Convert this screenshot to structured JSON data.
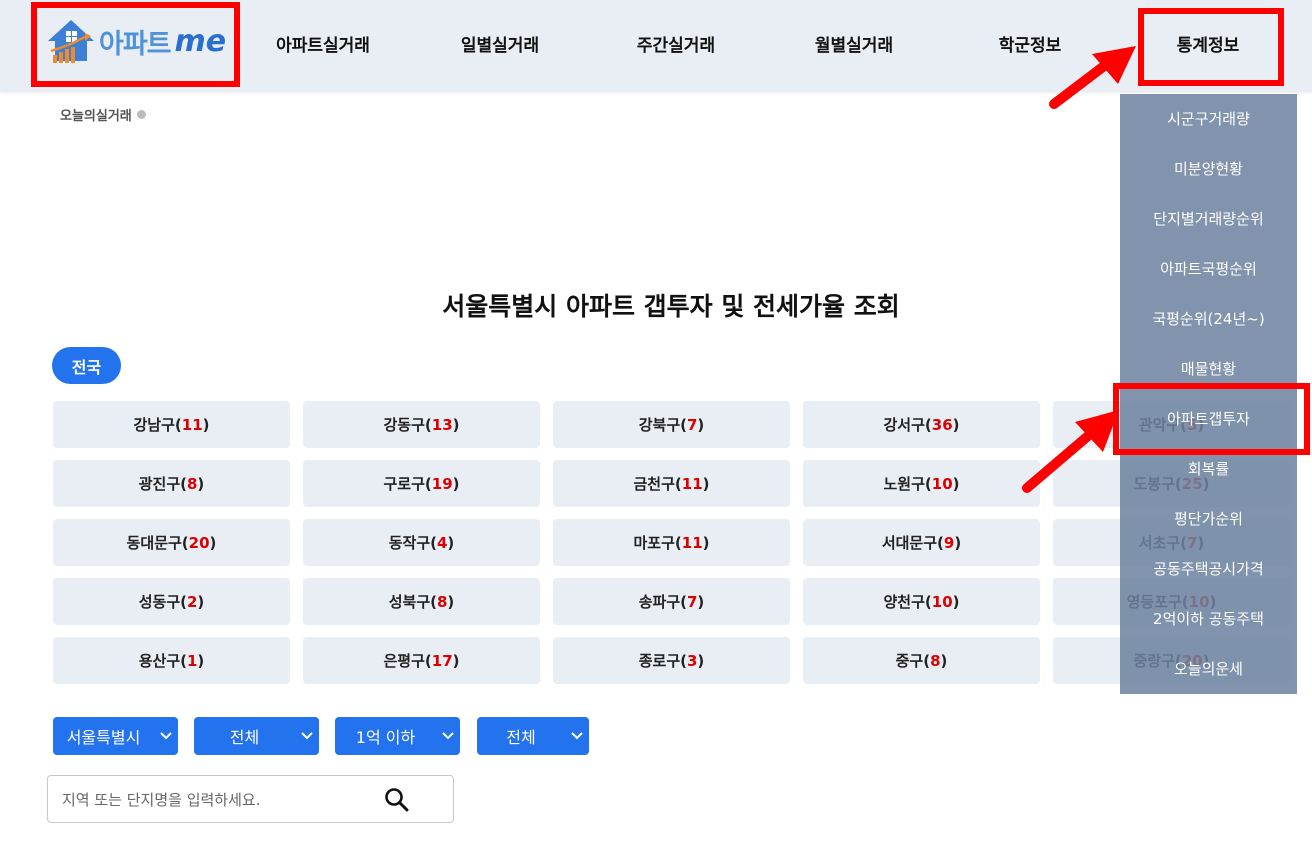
{
  "logo": {
    "text": "아파트",
    "me": "me"
  },
  "nav": {
    "items": [
      "아파트실거래",
      "일별실거래",
      "주간실거래",
      "월별실거래",
      "학군정보",
      "통계정보"
    ]
  },
  "today_label": "오늘의실거래",
  "title": "서울특별시 아파트 갭투자 및 전세가율 조회",
  "region_pill": "전국",
  "districts": [
    {
      "name": "강남구",
      "count": "11"
    },
    {
      "name": "강동구",
      "count": "13"
    },
    {
      "name": "강북구",
      "count": "7"
    },
    {
      "name": "강서구",
      "count": "36"
    },
    {
      "name": "관악구",
      "count": "5"
    },
    {
      "name": "광진구",
      "count": "8"
    },
    {
      "name": "구로구",
      "count": "19"
    },
    {
      "name": "금천구",
      "count": "11"
    },
    {
      "name": "노원구",
      "count": "10"
    },
    {
      "name": "도봉구",
      "count": "25"
    },
    {
      "name": "동대문구",
      "count": "20"
    },
    {
      "name": "동작구",
      "count": "4"
    },
    {
      "name": "마포구",
      "count": "11"
    },
    {
      "name": "서대문구",
      "count": "9"
    },
    {
      "name": "서초구",
      "count": "7"
    },
    {
      "name": "성동구",
      "count": "2"
    },
    {
      "name": "성북구",
      "count": "8"
    },
    {
      "name": "송파구",
      "count": "7"
    },
    {
      "name": "양천구",
      "count": "10"
    },
    {
      "name": "영등포구",
      "count": "10"
    },
    {
      "name": "용산구",
      "count": "1"
    },
    {
      "name": "은평구",
      "count": "17"
    },
    {
      "name": "종로구",
      "count": "3"
    },
    {
      "name": "중구",
      "count": "8"
    },
    {
      "name": "중랑구",
      "count": "20"
    }
  ],
  "filters": [
    "서울특별시",
    "전체",
    "1억 이하",
    "전체"
  ],
  "search": {
    "placeholder": "지역 또는 단지명을 입력하세요."
  },
  "stats_menu": [
    "시군구거래량",
    "미분양현황",
    "단지별거래량순위",
    "아파트국평순위",
    "국평순위(24년~)",
    "매물현황",
    "아파트갭투자",
    "회복률",
    "평단가순위",
    "공동주택공시가격",
    "2억이하 공동주택",
    "오늘의운세"
  ],
  "colors": {
    "accent": "#2372ee",
    "highlight": "#ff0000",
    "count": "#dd0000"
  }
}
